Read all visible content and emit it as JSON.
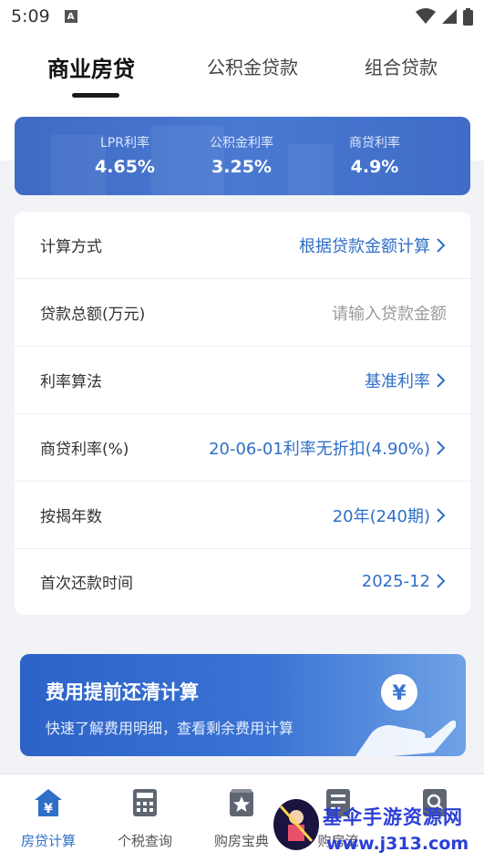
{
  "status_bar": {
    "time": "5:09",
    "notification_badge": "A"
  },
  "tabs": [
    {
      "label": "商业房贷",
      "active": true
    },
    {
      "label": "公积金贷款",
      "active": false
    },
    {
      "label": "组合贷款",
      "active": false
    }
  ],
  "rates": [
    {
      "label": "LPR利率",
      "value": "4.65%"
    },
    {
      "label": "公积金利率",
      "value": "3.25%"
    },
    {
      "label": "商贷利率",
      "value": "4.9%"
    }
  ],
  "form": {
    "calc_method": {
      "label": "计算方式",
      "value": "根据贷款金额计算"
    },
    "loan_amount": {
      "label": "贷款总额(万元)",
      "placeholder": "请输入贷款金额"
    },
    "rate_method": {
      "label": "利率算法",
      "value": "基准利率"
    },
    "commercial_rate": {
      "label": "商贷利率(%)",
      "value": "20-06-01利率无折扣(4.90%)"
    },
    "mortgage_years": {
      "label": "按揭年数",
      "value": "20年(240期)"
    },
    "first_payment": {
      "label": "首次还款时间",
      "value": "2025-12"
    }
  },
  "promo": {
    "title": "费用提前还清计算",
    "subtitle": "快速了解费用明细，查看剩余费用计算",
    "icon": "yen-hand-icon"
  },
  "bottom_nav": [
    {
      "label": "房贷计算",
      "icon": "house-yen-icon",
      "active": true
    },
    {
      "label": "个税查询",
      "icon": "calculator-icon",
      "active": false
    },
    {
      "label": "购房宝典",
      "icon": "star-book-icon",
      "active": false
    },
    {
      "label": "购房流",
      "icon": "checklist-icon",
      "active": false
    },
    {
      "label": "",
      "icon": "search-icon",
      "active": false
    }
  ],
  "watermark": {
    "line1": "基伞手游资源网",
    "line2": "www.j313.com"
  },
  "colors": {
    "accent": "#2f6fc7",
    "banner": "#4a79d2",
    "promo": "#2d63c7"
  }
}
